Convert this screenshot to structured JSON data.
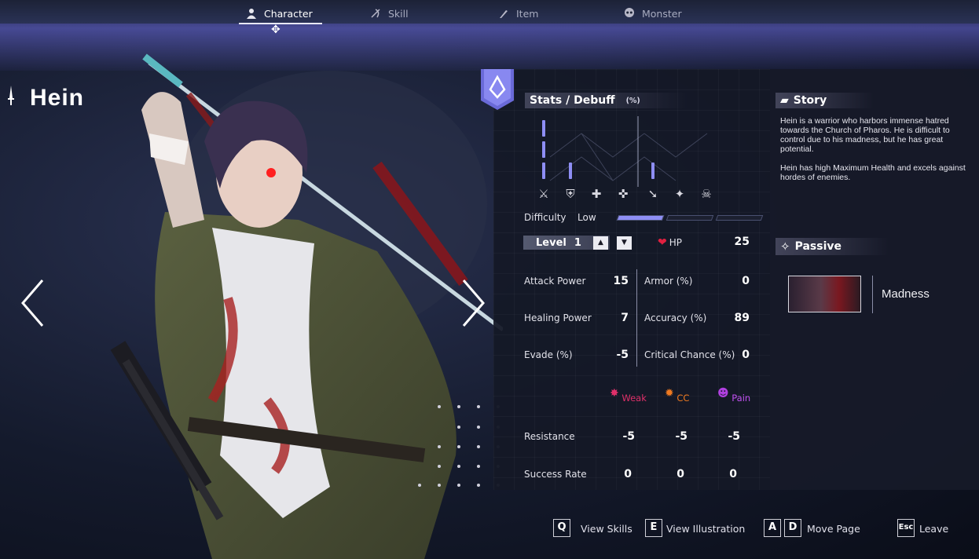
{
  "tabs": [
    {
      "label": "Character",
      "icon": "person-icon",
      "active": true
    },
    {
      "label": "Skill",
      "icon": "skill-icon",
      "active": false
    },
    {
      "label": "Item",
      "icon": "brush-icon",
      "active": false
    },
    {
      "label": "Monster",
      "icon": "skull-icon",
      "active": false
    }
  ],
  "character": {
    "name": "Hein",
    "icon": "sword-icon"
  },
  "stats_panel": {
    "title": "Stats / Debuff",
    "unit": "(%)",
    "bar_values": [
      3,
      1,
      0,
      0,
      1,
      0,
      0
    ],
    "icons": [
      "sword-icon",
      "shield-icon",
      "plus-icon",
      "heal-icon",
      "arrow-down-icon",
      "crystal-icon",
      "skull-icon"
    ],
    "difficulty_label": "Difficulty",
    "difficulty_value": "Low",
    "difficulty_level": 1,
    "difficulty_max": 3
  },
  "level": {
    "label": "Level",
    "value": "1",
    "up_icon": "triangle-up-icon",
    "down_icon": "triangle-down-icon"
  },
  "hp": {
    "label": "HP",
    "value": "25",
    "icon": "heart-icon"
  },
  "stats": {
    "attack_power": {
      "label": "Attack Power",
      "value": "15"
    },
    "healing_power": {
      "label": "Healing Power",
      "value": "7"
    },
    "evade": {
      "label": "Evade (%)",
      "value": "-5"
    },
    "armor": {
      "label": "Armor (%)",
      "value": "0"
    },
    "accuracy": {
      "label": "Accuracy (%)",
      "value": "89"
    },
    "critical": {
      "label": "Critical Chance (%)",
      "value": "0"
    }
  },
  "debuffs": {
    "weak": {
      "label": "Weak",
      "color": "#e0306a"
    },
    "cc": {
      "label": "CC",
      "color": "#f07a20"
    },
    "pain": {
      "label": "Pain",
      "color": "#b040e0"
    }
  },
  "resistance": {
    "label": "Resistance",
    "values": [
      "-5",
      "-5",
      "-5"
    ]
  },
  "success_rate": {
    "label": "Success Rate",
    "values": [
      "0",
      "0",
      "0"
    ]
  },
  "story": {
    "title": "Story",
    "paragraphs": [
      "Hein is a warrior who harbors immense hatred towards the Church of Pharos. He is difficult to control due to his madness, but he has great potential.",
      "Hein has high Maximum Health and excels against hordes of enemies."
    ]
  },
  "passive": {
    "title": "Passive",
    "name": "Madness"
  },
  "footer": [
    {
      "key": "Q",
      "label": "View Skills"
    },
    {
      "key": "E",
      "label": "View Illustration"
    },
    {
      "keys": [
        "A",
        "D"
      ],
      "label": "Move Page"
    },
    {
      "key": "Esc",
      "label": "Leave"
    }
  ],
  "colors": {
    "accent": "#8e8ef4",
    "panel": "#181c2c"
  }
}
